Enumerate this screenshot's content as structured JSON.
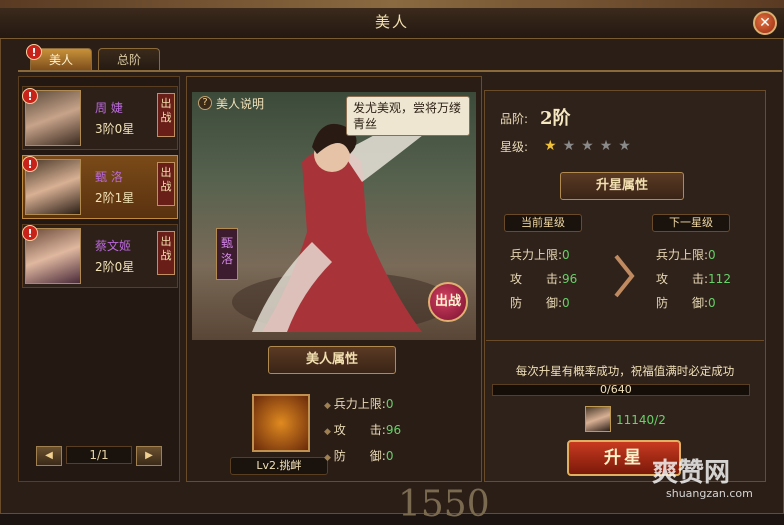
{
  "window": {
    "title": "美人",
    "close_icon": "close-icon"
  },
  "tabs": [
    {
      "label": "美人",
      "active": true
    },
    {
      "label": "总阶",
      "active": false
    }
  ],
  "beauties": [
    {
      "name": "周 婕",
      "rank": "3阶0星",
      "badge": "出战",
      "alert": "!"
    },
    {
      "name": "甄 洛",
      "rank": "2阶1星",
      "badge": "出战",
      "alert": "!",
      "selected": true
    },
    {
      "name": "蔡文姬",
      "rank": "2阶0星",
      "badge": "出战",
      "alert": "!"
    }
  ],
  "pager": {
    "text": "1/1",
    "prev": "◀",
    "next": "▶"
  },
  "center": {
    "help_label": "美人说明",
    "help_icon": "?",
    "quote": "发尤美观，尝将万缕青丝",
    "side_name": "甄洛",
    "fight_label": "出战",
    "attr_ribbon": "美人属性",
    "skill_label": "Lv2.挑衅",
    "stats": [
      {
        "label": "兵力上限:",
        "value": "0"
      },
      {
        "label": "攻　　击:",
        "value": "96"
      },
      {
        "label": "防　　御:",
        "value": "0"
      }
    ]
  },
  "right": {
    "grade_label": "品阶:",
    "grade_value": "2阶",
    "star_label": "星级:",
    "stars_on": 1,
    "stars_total": 5,
    "upgrade_ribbon": "升星属性",
    "current_label": "当前星级",
    "next_label": "下一星级",
    "current_stats": [
      {
        "label": "兵力上限:",
        "value": "0"
      },
      {
        "label": "攻　　击:",
        "value": "96"
      },
      {
        "label": "防　　御:",
        "value": "0"
      }
    ],
    "next_stats": [
      {
        "label": "兵力上限:",
        "value": "0"
      },
      {
        "label": "攻　　击:",
        "value": "112"
      },
      {
        "label": "防　　御:",
        "value": "0"
      }
    ],
    "hint": "每次升星有概率成功，祝福值满时必定成功",
    "progress_text": "0/640",
    "progress_fraction": 0.0,
    "cost_text": "11140/2",
    "upgrade_button": "升星"
  },
  "watermark": {
    "brand": "爽赞网",
    "url": "shuangzan.com"
  },
  "background_number": "1550",
  "colors": {
    "accent": "#c8923a",
    "name_purple": "#b96ad8",
    "value_green": "#6ad06a",
    "alert_red": "#c8231a"
  }
}
